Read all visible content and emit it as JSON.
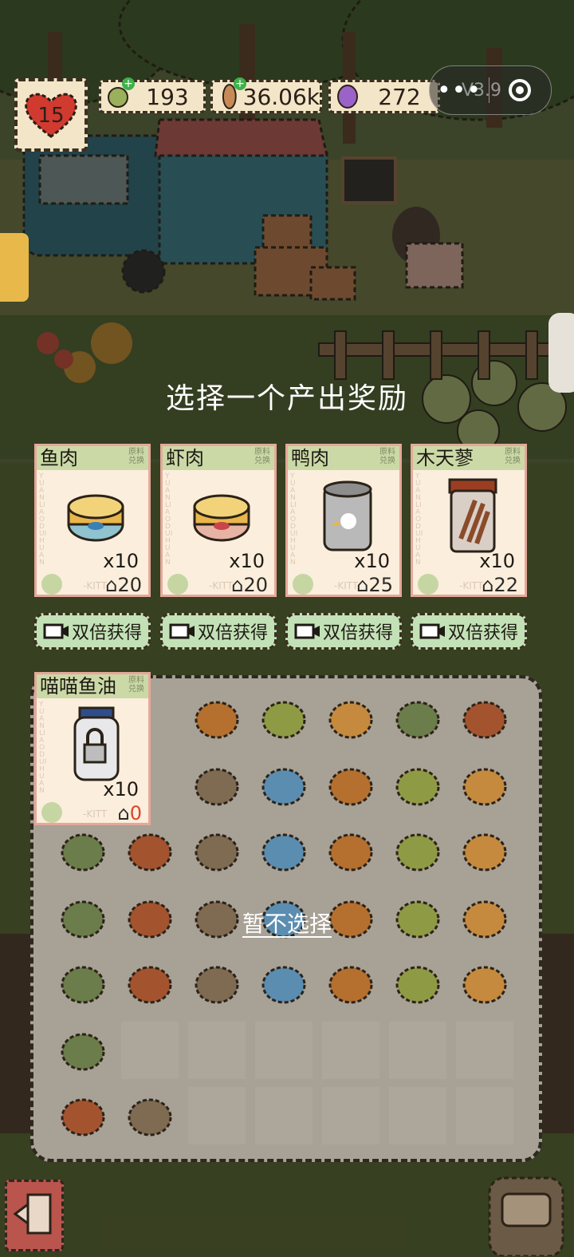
{
  "hud": {
    "level": "15",
    "resources": [
      {
        "name": "catnip",
        "value": "193"
      },
      {
        "name": "dried-fish",
        "value": "36.06k"
      },
      {
        "name": "gem",
        "value": "272"
      }
    ],
    "capsule": {
      "more": "•••",
      "version": "V3.9"
    }
  },
  "prompt": "选择一个产出奖励",
  "cards": [
    {
      "name": "鱼肉",
      "tag": "原料兑换",
      "vertical": "YUANLIAODUIHUAN",
      "qty": "x10",
      "cost": "20",
      "footer": "-KITT",
      "icon": "fish-can-icon"
    },
    {
      "name": "虾肉",
      "tag": "原料兑换",
      "vertical": "YUANLIAODUIHUAN",
      "qty": "x10",
      "cost": "20",
      "footer": "-KITT",
      "icon": "shrimp-can-icon"
    },
    {
      "name": "鸭肉",
      "tag": "原料兑换",
      "vertical": "YUANLIAODUIHUAN",
      "qty": "x10",
      "cost": "25",
      "footer": "-KITT",
      "icon": "duck-can-icon"
    },
    {
      "name": "木天蓼",
      "tag": "原料兑换",
      "vertical": "YUANLIAODUIHUAN",
      "qty": "x10",
      "cost": "22",
      "footer": "-KITT",
      "icon": "silvervine-jar-icon"
    }
  ],
  "double_button_label": "双倍获得",
  "locked_card": {
    "name": "喵喵鱼油",
    "tag": "原料兑换",
    "vertical": "YUANLIAODUIHUAN",
    "qty": "x10",
    "cost": "0",
    "footer": "-KITT",
    "icon": "locked-fish-oil-jar-icon"
  },
  "skip_label": "暂不选择",
  "inventory_icons": [
    "basket-icon",
    "cookie-stack-icon",
    "box-icon",
    "box-icon",
    "box-icon",
    "veggie-crate-icon",
    "green-onion-icon",
    "lily-pad-icon",
    "chili-icon",
    "wheat-icon",
    "fish-icon",
    "salmon-icon",
    "cabbage-icon",
    "potato-icon",
    "bag-icon",
    "sack-icon",
    "mushroom-icon",
    "bamboo-icon",
    "sponge-icon",
    "herb-icon",
    "ginger-icon",
    "packet-icon",
    "dried-fish-icon",
    "chest-icon",
    "clover-icon",
    "pea-icon",
    "bucket-icon",
    "flower-basket-icon",
    "shrimp-icon",
    "bag-icon",
    "snail-icon",
    "fluffy-icon",
    "frog-icon"
  ]
}
